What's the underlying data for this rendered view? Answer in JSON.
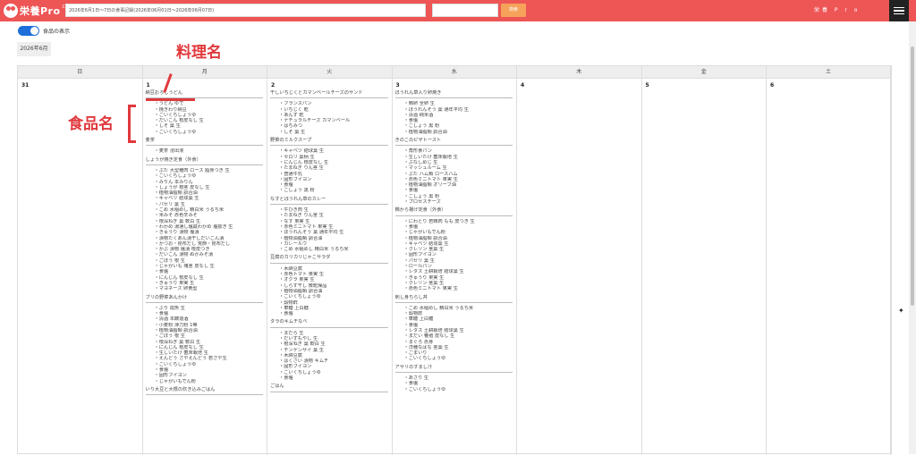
{
  "header": {
    "logo_text": "栄養Pro",
    "logo_sup": "Cloud",
    "search_value": "2026年6月1日～7日の食事記録(2026年06月01日～2026年06月07日)",
    "search_button": "検索",
    "app_title": "栄養 P r o",
    "menu_icon": "hamburger-icon"
  },
  "toolbar": {
    "toggle_label": "食品の表示",
    "month": "2026年6月"
  },
  "annotations": {
    "dish_label": "料理名",
    "food_label": "食品名"
  },
  "weekdays": [
    "日",
    "月",
    "火",
    "水",
    "木",
    "金",
    "土"
  ],
  "days": [
    {
      "num": "31",
      "dishes": []
    },
    {
      "num": "1",
      "dishes": [
        {
          "name": "納豆おろしうどん",
          "foods": [
            "うどん ゆで",
            "挽きわり納豆",
            "こいくちしょうゆ",
            "だいこん 根皮なし 生",
            "しそ 葉 生",
            "こいくちしょうゆ"
          ]
        },
        {
          "name": "麦茶",
          "foods": [
            "麦茶 浸出液"
          ]
        },
        {
          "name": "しょうが焼き定食（外食）",
          "foods": [
            "ぶた 大型種肉 ロース 脂身つき 生",
            "こいくちしょうゆ",
            "みりん 本みりん",
            "しょうが 根茎 皮なし 生",
            "植物油脂類 調合油",
            "キャベツ 結球葉 生",
            "パセリ 葉 生",
            "こめ 水稲めし 精白米 うるち米",
            "米みそ 赤色辛みそ",
            "根深ねぎ 葉 軟白 生",
            "わかめ 湯通し塩蔵わかめ 塩抜き 生",
            "きゅうり 漬物 塩漬",
            "漬物たくあん漬干しだいこん漬",
            "かつお・昆布だし 荒節・昆布だし",
            "かぶ 漬物 塩漬 根皮つき",
            "だいこん 漬物 ぬかみそ漬",
            "ごぼう 根 生",
            "じゃがいも 塊茎 皮なし 生",
            "食塩",
            "にんじん 根皮なし 生",
            "きゅうり 果実 生",
            "マヨネーズ 卵黄型"
          ]
        },
        {
          "name": "ブリの野菜あんかけ",
          "foods": [
            "ぶり 成魚 生",
            "食塩",
            "清酒 本醸造酒",
            "小麦粉 薄力粉 1等",
            "植物油脂類 調合油",
            "ごぼう 根 生",
            "根深ねぎ 葉 軟白 生",
            "にんじん 根皮なし 生",
            "生しいたけ 菌床栽培 生",
            "えんどう さやえんどう 若ざや生",
            "こいくちしょうゆ",
            "食塩",
            "固形ブイヨン",
            "じゃがいもでん粉"
          ]
        },
        {
          "name": "いり大豆と大根の炊き込みごはん",
          "foods": []
        }
      ]
    },
    {
      "num": "2",
      "dishes": [
        {
          "name": "干しいちじくとカマンベールチーズのサンド",
          "foods": [
            "フランスパン",
            "いちじく 乾",
            "あんず 乾",
            "ナチュラルチーズ カマンベール",
            "はちみつ",
            "しそ 葉 生"
          ]
        },
        {
          "name": "野菜のミルクスープ",
          "foods": [
            "キャベツ 結球葉 生",
            "セロリ 葉柄 生",
            "にんじん 根皮なし 生",
            "たまねぎ りん茎 生",
            "普通牛乳",
            "固形ブイヨン",
            "食塩",
            "こしょう 黒 粉"
          ]
        },
        {
          "name": "なすとほうれん草のカレー",
          "foods": [
            "牛ひき肉 生",
            "たまねぎ りん茎 生",
            "なす 果実 生",
            "赤色ミニトマト 果実 生",
            "ほうれんそう 葉 通年平均 生",
            "植物油脂類 調合油",
            "カレールウ",
            "こめ 水稲めし 精白米 うるち米"
          ]
        },
        {
          "name": "豆腐のカリカリじゃこサラダ",
          "foods": [
            "木綿豆腐",
            "赤色トマト 果実 生",
            "オクラ 果実 生",
            "しらす干し 微乾燥品",
            "植物油脂類 調合油",
            "こいくちしょうゆ",
            "穀物酢",
            "車糖 上白糖",
            "食塩"
          ]
        },
        {
          "name": "タラのキムチなべ",
          "foods": [
            "まだら 生",
            "だいずもやし 生",
            "根深ねぎ 葉 軟白 生",
            "チンゲンサイ 葉 生",
            "木綿豆腐",
            "はくさい 漬物 キムチ",
            "固形ブイヨン",
            "こいくちしょうゆ",
            "食塩"
          ]
        },
        {
          "name": "ごはん",
          "foods": []
        }
      ]
    },
    {
      "num": "3",
      "dishes": [
        {
          "name": "ほうれん草入り卵焼き",
          "foods": [
            "鶏卵 全卵 生",
            "ほうれんそう 葉 通年平均 生",
            "清酒 純米酒",
            "食塩",
            "こしょう 黒 粉",
            "植物油脂類 調合油"
          ]
        },
        {
          "name": "きのこのピザトースト",
          "foods": [
            "角形食パン",
            "生しいたけ 菌床栽培 生",
            "ぶなしめじ 生",
            "マッシュルーム 生",
            "ぶた ハム類 ロースハム",
            "赤色ミニトマト 果実 生",
            "植物油脂類 オリーブ油",
            "食塩",
            "こしょう 黒 粉",
            "プロセスチーズ"
          ]
        },
        {
          "name": "鶏から揚げ定食（外食）",
          "foods": [
            "にわとり 若鶏肉 もも 皮つき 生",
            "食塩",
            "じゃがいもでん粉",
            "植物油脂類 調合油",
            "キャベツ 結球葉 生",
            "クレソン 茎葉 生",
            "固形ブイヨン",
            "パセリ 葉 生",
            "ロールパン",
            "レタス 土耕栽培 結球葉 生",
            "きゅうり 果実 生",
            "クレソン 茎葉 生",
            "赤色ミニトマト 果実 生"
          ]
        },
        {
          "name": "刺し身ちらし丼",
          "foods": [
            "こめ 水稲めし 精白米 うるち米",
            "穀物酢",
            "車糖 上白糖",
            "食塩",
            "レタス 土耕栽培 結球葉 生",
            "まだい 養殖 皮なし 生",
            "まぐろ 赤身",
            "洋種なばな 茎葉 生",
            "ごまいり",
            "こいくちしょうゆ"
          ]
        },
        {
          "name": "アサリのすまし汁",
          "foods": [
            "あさり 生",
            "食塩",
            "こいくちしょうゆ"
          ]
        }
      ]
    },
    {
      "num": "4",
      "dishes": []
    },
    {
      "num": "5",
      "dishes": []
    },
    {
      "num": "6",
      "dishes": []
    }
  ]
}
